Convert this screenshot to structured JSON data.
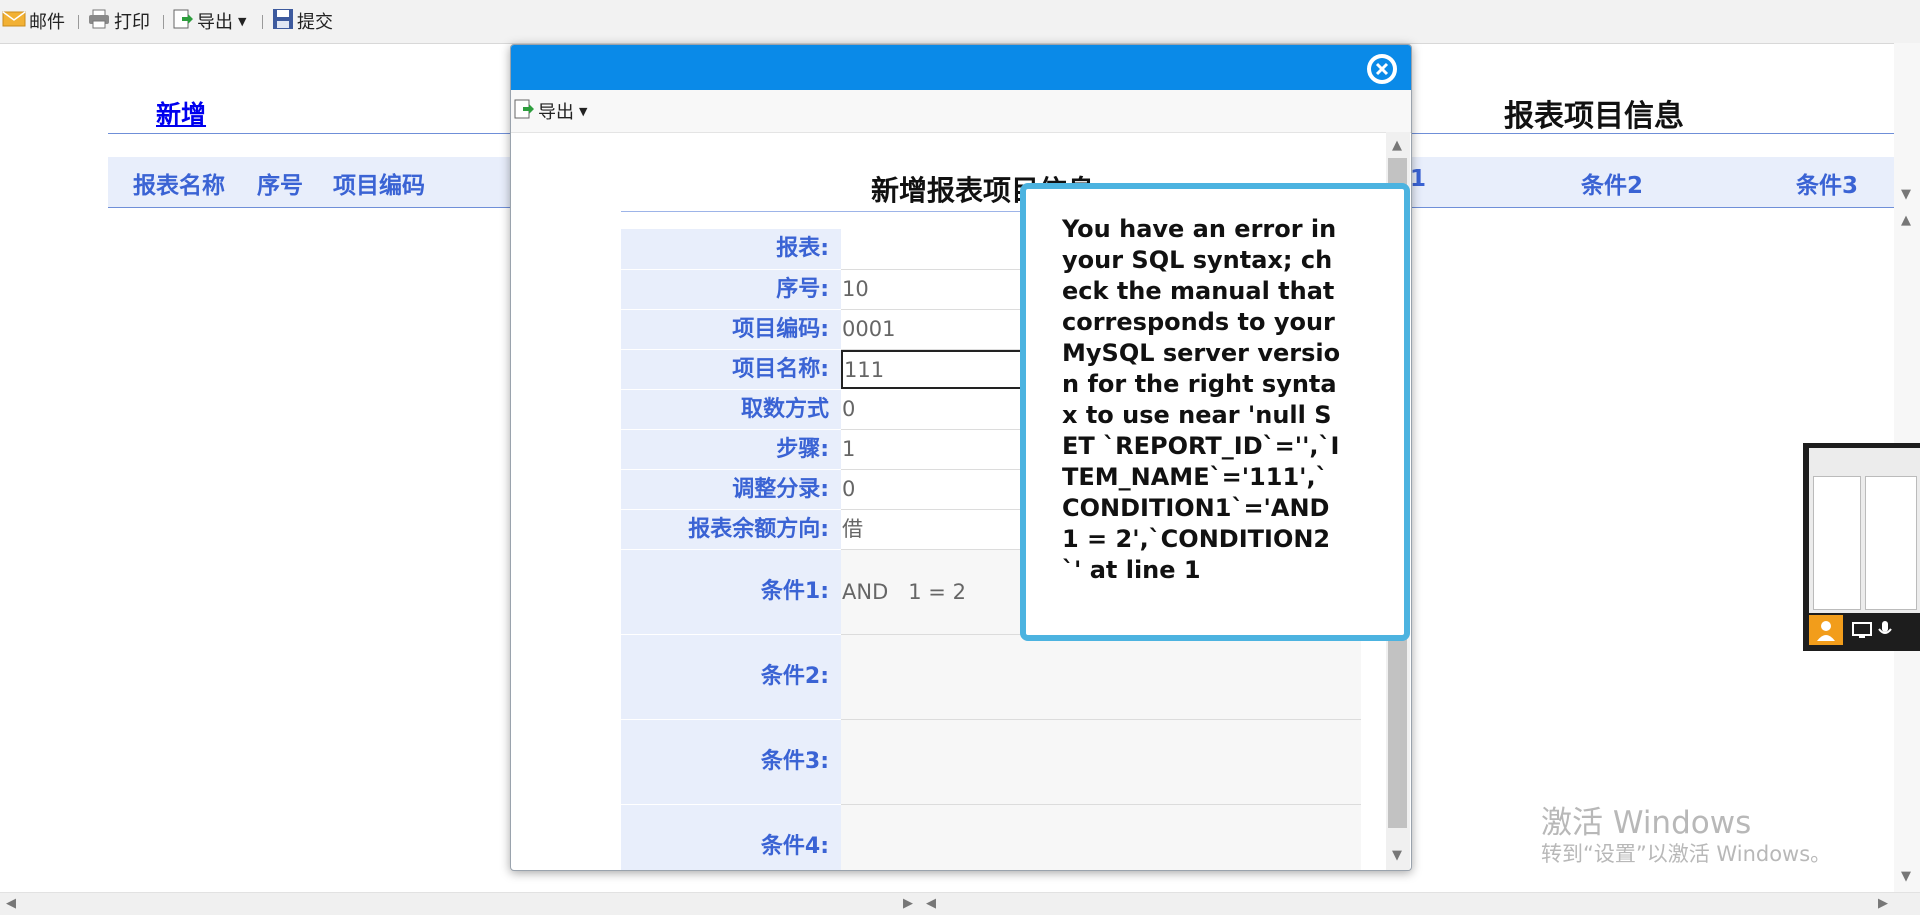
{
  "toolbar": {
    "mail": "邮件",
    "print": "打印",
    "export": "导出",
    "submit": "提交"
  },
  "page": {
    "new_link": "新增",
    "title": "报表项目信息",
    "columns": [
      "报表名称",
      "序号",
      "项目编码",
      "1",
      "条件2",
      "条件3"
    ]
  },
  "dialog": {
    "export": "导出",
    "form_title": "新增报表项目信息",
    "rows": [
      {
        "label": "报表:",
        "value": ""
      },
      {
        "label": "序号:",
        "value": "10"
      },
      {
        "label": "项目编码:",
        "value": "0001"
      },
      {
        "label": "项目名称:",
        "value": "111"
      },
      {
        "label": "取数方式",
        "value": "0"
      },
      {
        "label": "步骤:",
        "value": "1"
      },
      {
        "label": "调整分录:",
        "value": "0"
      },
      {
        "label": "报表余额方向:",
        "value": "借"
      },
      {
        "label": "条件1:",
        "value": "AND   1 = 2"
      },
      {
        "label": "条件2:",
        "value": ""
      },
      {
        "label": "条件3:",
        "value": ""
      },
      {
        "label": "条件4:",
        "value": ""
      }
    ]
  },
  "error": {
    "message": "You have an error in your SQL syntax; check the manual that corresponds to your MySQL server version for the right syntax to use near 'null SET `REPORT_ID`='',`ITEM_NAME`='111',`CONDITION1`='AND 1 = 2',`CONDITION2`' at line 1"
  },
  "watermark": {
    "line1": "激活 Windows",
    "line2": "转到“设置”以激活 Windows。"
  },
  "colors": {
    "accent": "#0a8ae8",
    "header_bg": "#e8eefb",
    "label_text": "#3a63d4",
    "tooltip_border": "#4cb3e0"
  }
}
